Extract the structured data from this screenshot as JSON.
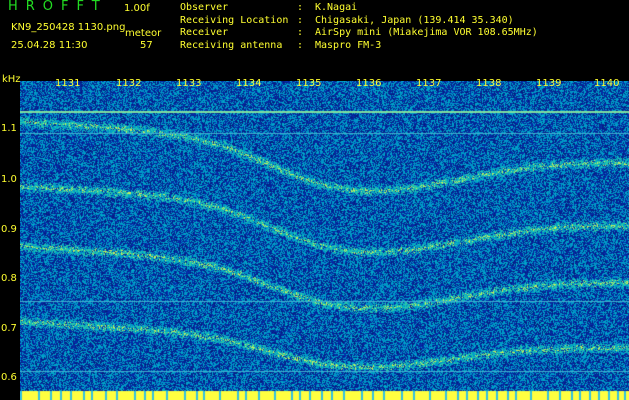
{
  "header": {
    "app_title": "HROFFT",
    "version": "1.00f",
    "filename": "KN9_250428 1130.png",
    "date": "25.04.28 11:30",
    "meteor_label": "meteor",
    "meteor_count": "57",
    "info": [
      {
        "key": "Observer",
        "colon": ":",
        "value": "K.Nagai"
      },
      {
        "key": "Receiving Location",
        "colon": ":",
        "value": "Chigasaki, Japan (139.414 35.340)"
      },
      {
        "key": "Receiver",
        "colon": ":",
        "value": "AirSpy mini (Miakejima VOR 108.65MHz)"
      },
      {
        "key": "Receiving antenna",
        "colon": ":",
        "value": "Maspro FM-3"
      }
    ]
  },
  "axis": {
    "y_unit": "kHz",
    "x_ticks": [
      "1131",
      "1132",
      "1133",
      "1134",
      "1135",
      "1136",
      "1137",
      "1138",
      "1139",
      "1140"
    ],
    "y_ticks": [
      "1.1",
      "1.0",
      "0.9",
      "0.8",
      "0.7",
      "0.6"
    ]
  },
  "colors": {
    "background": "#000000",
    "text": "#ffff30",
    "title": "#22dd22",
    "waterfall_base": "#0a1f8c"
  }
}
